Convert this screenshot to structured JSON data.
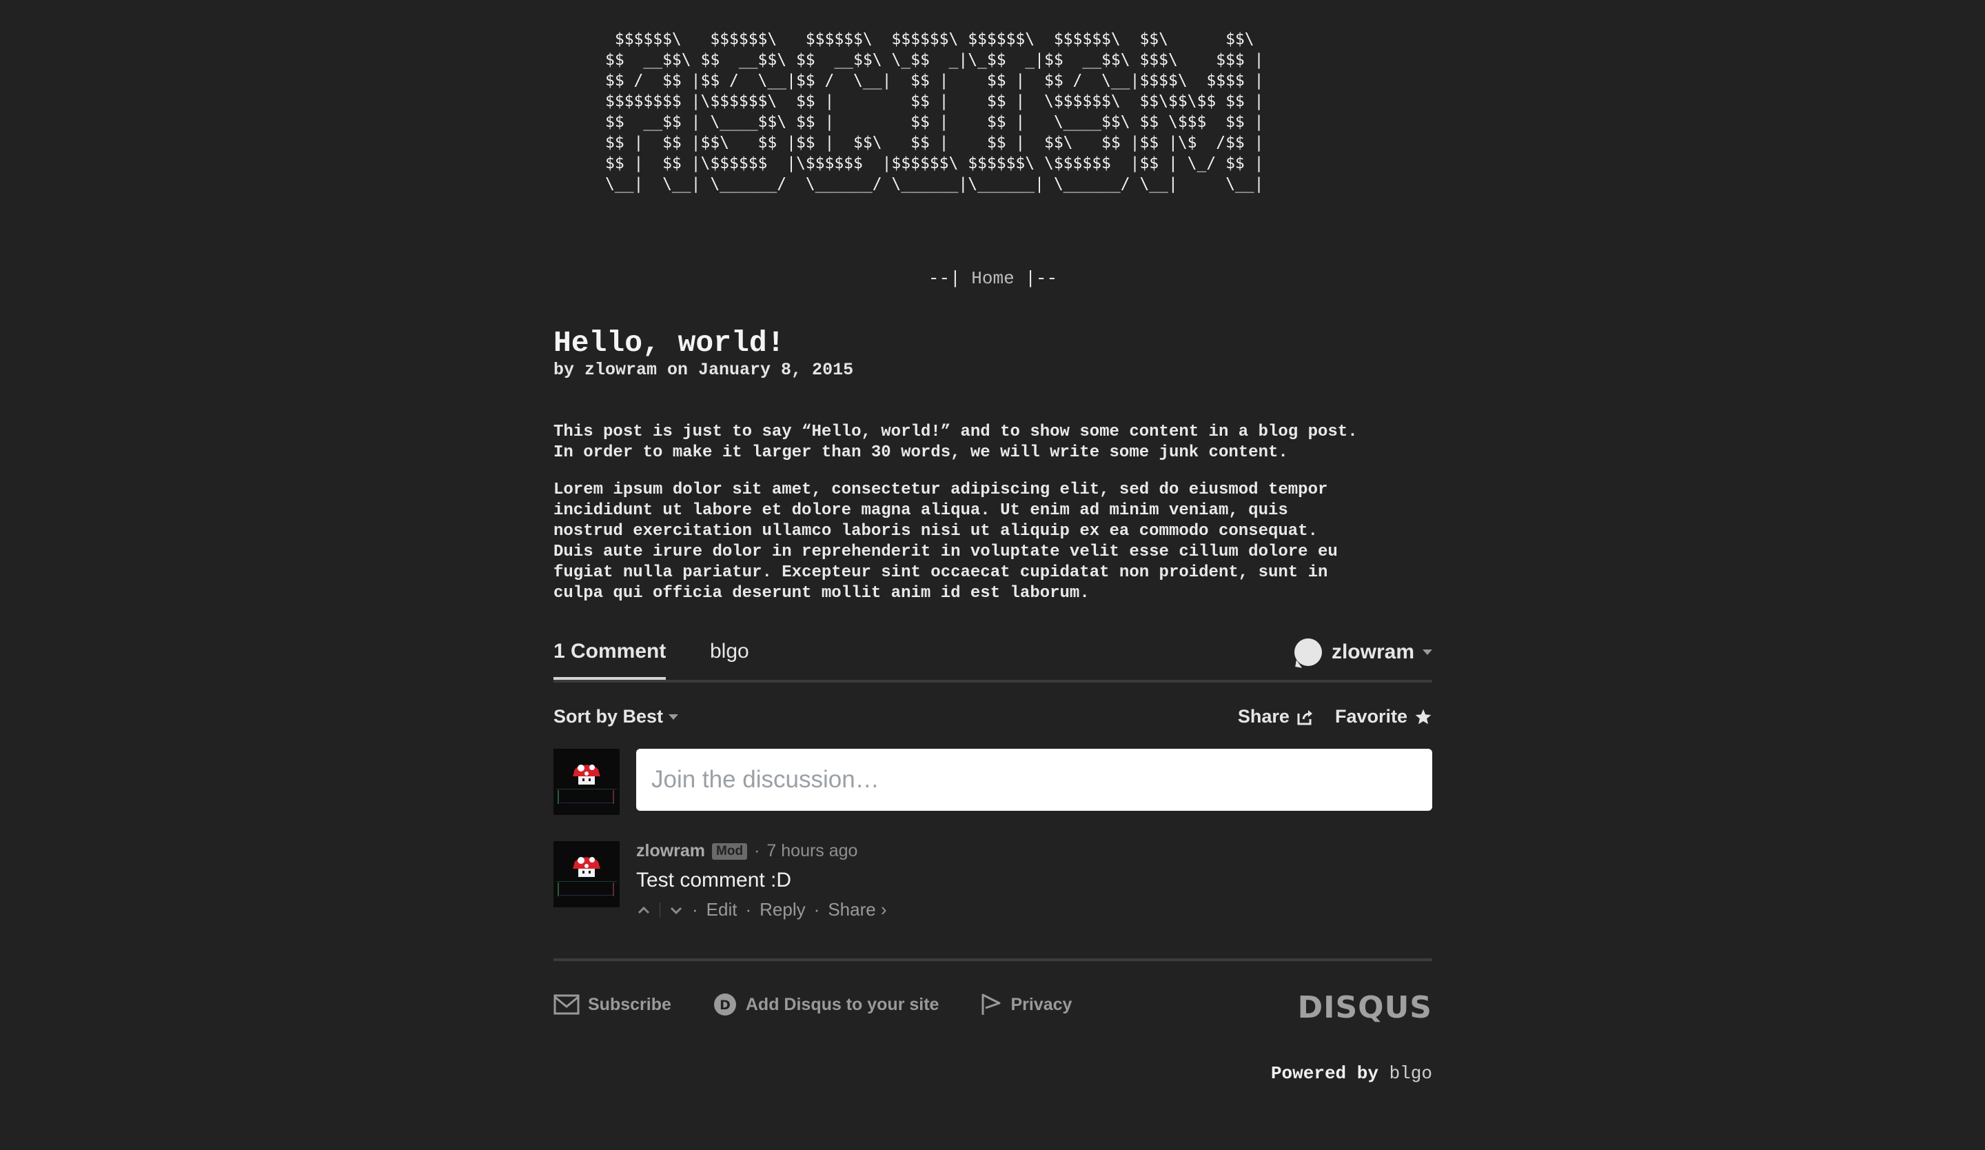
{
  "banner": {
    "ascii": " $$$$$$\\   $$$$$$\\   $$$$$$\\  $$$$$$\\ $$$$$$\\  $$$$$$\\  $$\\      $$\\\n$$  __$$\\ $$  __$$\\ $$  __$$\\ \\_$$  _|\\_$$  _|$$  __$$\\ $$$\\    $$$ |\n$$ /  $$ |$$ /  \\__|$$ /  \\__|  $$ |    $$ |  $$ /  \\__|$$$$\\  $$$$ |\n$$$$$$$$ |\\$$$$$$\\  $$ |        $$ |    $$ |  \\$$$$$$\\  $$\\$$\\$$ $$ |\n$$  __$$ | \\____$$\\ $$ |        $$ |    $$ |   \\____$$\\ $$ \\$$$  $$ |\n$$ |  $$ |$$\\   $$ |$$ |  $$\\   $$ |    $$ |  $$\\   $$ |$$ |\\$  /$$ |\n$$ |  $$ |\\$$$$$$  |\\$$$$$$  |$$$$$$\\ $$$$$$\\ \\$$$$$$  |$$ | \\_/ $$ |\n\\__|  \\__| \\______/  \\______/ \\______|\\______| \\______/ \\__|     \\__|"
  },
  "nav": {
    "prefix": "--| ",
    "home": "Home",
    "suffix": " |--"
  },
  "post": {
    "title": "Hello, world!",
    "byline": "by zlowram on January 8, 2015",
    "paragraphs": [
      "This post is just to say “Hello, world!” and to show some content in a blog post.\nIn order to make it larger than 30 words, we will write some junk content.",
      "Lorem ipsum dolor sit amet, consectetur adipiscing elit, sed do eiusmod tempor\nincididunt ut labore et dolore magna aliqua. Ut enim ad minim veniam, quis\nnostrud exercitation ullamco laboris nisi ut aliquip ex ea commodo consequat.\nDuis aute irure dolor in reprehenderit in voluptate velit esse cillum dolore eu\nfugiat nulla pariatur. Excepteur sint occaecat cupidatat non proident, sunt in\nculpa qui officia deserunt mollit anim id est laborum."
    ]
  },
  "disqus": {
    "tab_comments": "1 Comment",
    "tab_forum": "blgo",
    "user": "zlowram",
    "sort_label": "Sort by Best",
    "share_label": "Share",
    "favorite_label": "Favorite",
    "input_placeholder": "Join the discussion…",
    "comment": {
      "author": "zlowram",
      "badge": "Mod",
      "sep": "·",
      "time": "7 hours ago",
      "text": "Test comment :D",
      "edit": "Edit",
      "reply": "Reply",
      "share": "Share ›"
    },
    "footer": {
      "subscribe": "Subscribe",
      "add_disqus": "Add Disqus to your site",
      "privacy": "Privacy",
      "logo": "DISQUS"
    }
  },
  "powered": {
    "prefix": "Powered by ",
    "link": "blgo"
  },
  "colors": {
    "background": "#222222",
    "text": "#ececec",
    "muted": "#9a9a9a",
    "mushroom_red": "#d8202a"
  }
}
